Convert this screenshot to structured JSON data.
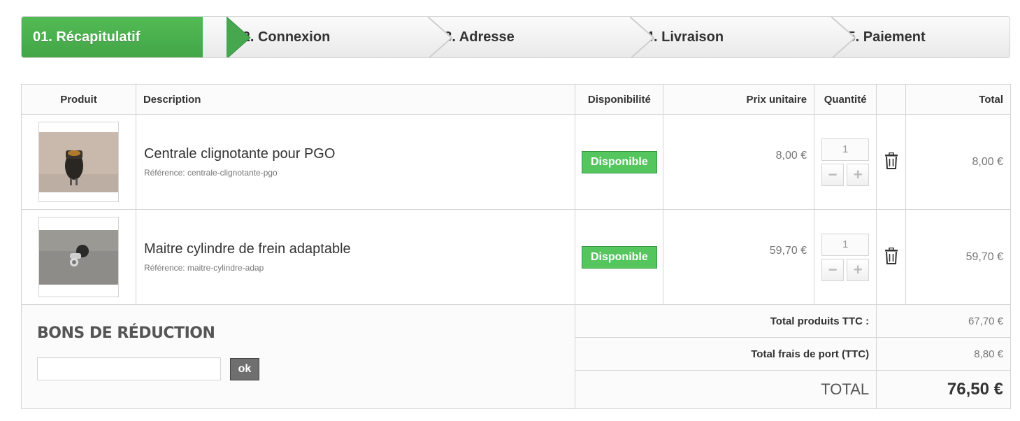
{
  "steps": [
    {
      "label": "01. Récapitulatif",
      "active": true
    },
    {
      "label": "02. Connexion"
    },
    {
      "label": "03. Adresse"
    },
    {
      "label": "04. Livraison"
    },
    {
      "label": "05. Paiement"
    }
  ],
  "table": {
    "headers": {
      "produit": "Produit",
      "description": "Description",
      "disponibilite": "Disponibilité",
      "prix_unitaire": "Prix unitaire",
      "quantite": "Quantité",
      "total": "Total"
    },
    "rows": [
      {
        "name": "Centrale clignotante pour PGO",
        "reference": "Référence: centrale-clignotante-pgo",
        "availability": "Disponible",
        "unit_price": "8,00 €",
        "quantity": "1",
        "total": "8,00 €"
      },
      {
        "name": "Maitre cylindre de frein adaptable",
        "reference": "Référence: maitre-cylindre-adap",
        "availability": "Disponible",
        "unit_price": "59,70 €",
        "quantity": "1",
        "total": "59,70 €"
      }
    ]
  },
  "voucher": {
    "title": "BONS DE RÉDUCTION",
    "input_value": "",
    "button_label": "ok"
  },
  "totals": {
    "products_label": "Total produits TTC :",
    "products_value": "67,70 €",
    "shipping_label": "Total frais de port (TTC)",
    "shipping_value": "8,80 €",
    "total_label": "TOTAL",
    "total_value": "76,50 €"
  },
  "colors": {
    "active_step": "#46a74e",
    "badge": "#55c65e",
    "border": "#d6d4d4"
  }
}
